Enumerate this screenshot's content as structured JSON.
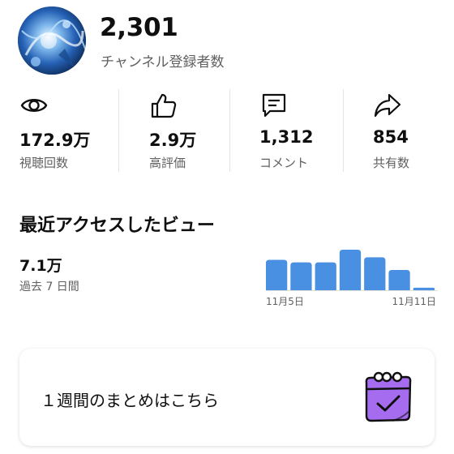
{
  "channel": {
    "subscriber_count": "2,301",
    "subscriber_label": "チャンネル登録者数"
  },
  "stats": [
    {
      "icon": "eye-icon",
      "value": "172.9万",
      "label": "視聴回数"
    },
    {
      "icon": "thumbs-up-icon",
      "value": "2.9万",
      "label": "高評価"
    },
    {
      "icon": "comment-icon",
      "value": "1,312",
      "label": "コメント"
    },
    {
      "icon": "share-icon",
      "value": "854",
      "label": "共有数"
    }
  ],
  "recent_views": {
    "title": "最近アクセスしたビュー",
    "value": "7.1万",
    "period": "過去 7 日間"
  },
  "chart_data": {
    "type": "bar",
    "categories": [
      "11月5日",
      "",
      "",
      "",
      "",
      "",
      "11月11日"
    ],
    "values": [
      36,
      33,
      33,
      48,
      39,
      24,
      3
    ],
    "tick_labels": [
      "11月5日",
      "11月11日"
    ],
    "bar_color": "#4a90e2",
    "grid": false
  },
  "summary_card": {
    "text": "１週間のまとめはこちら",
    "icon": "calendar-check-icon",
    "icon_color": "#9b5de5"
  },
  "colors": {
    "text_primary": "#0f0f0f",
    "text_secondary": "#606060",
    "bar": "#4a90e2"
  }
}
